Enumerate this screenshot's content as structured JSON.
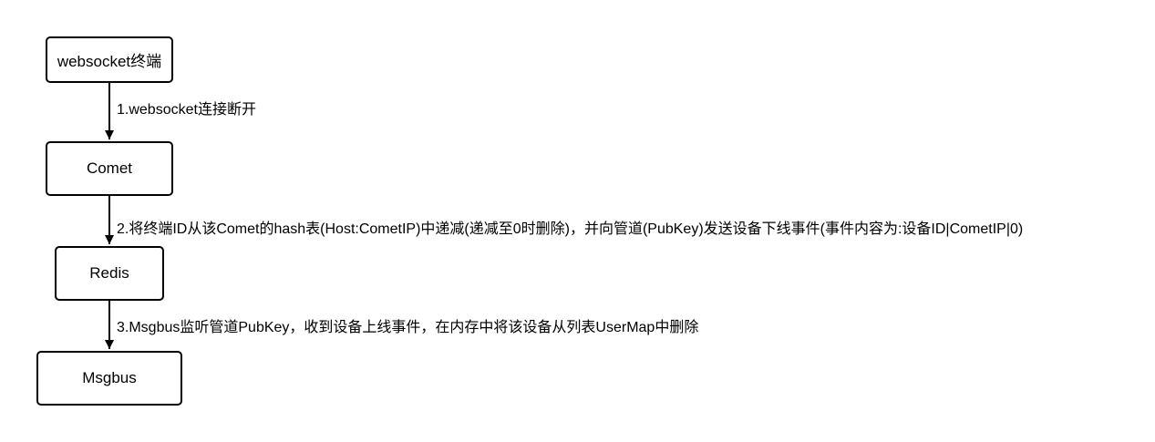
{
  "nodes": {
    "websocket": "websocket终端",
    "comet": "Comet",
    "redis": "Redis",
    "msgbus": "Msgbus"
  },
  "edges": {
    "step1": "1.websocket连接断开",
    "step2": "2.将终端ID从该Comet的hash表(Host:CometIP)中递减(递减至0时删除)，并向管道(PubKey)发送设备下线事件(事件内容为:设备ID|CometIP|0)",
    "step3": "3.Msgbus监听管道PubKey，收到设备上线事件，在内存中将该设备从列表UserMap中删除"
  }
}
